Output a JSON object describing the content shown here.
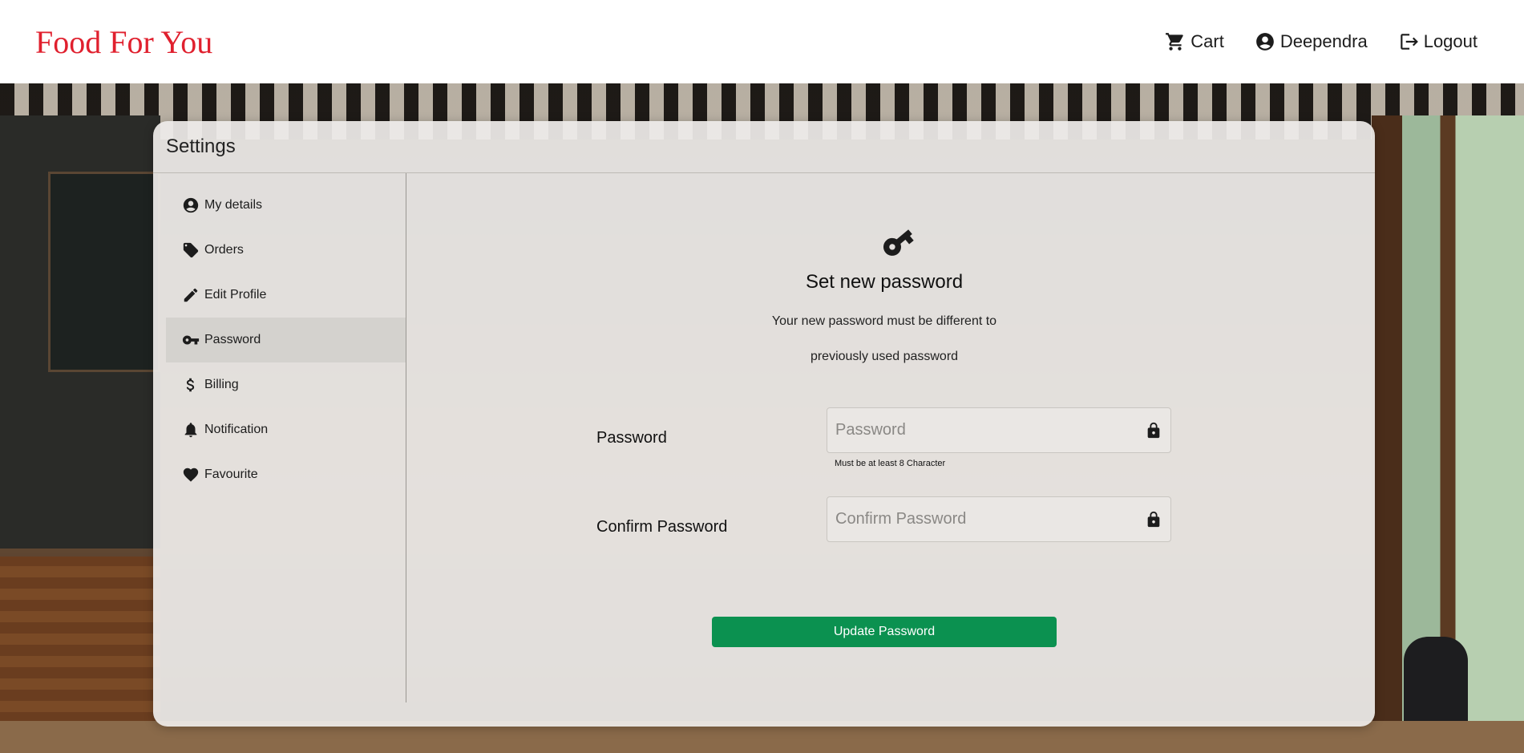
{
  "header": {
    "brand": "Food For You",
    "nav": [
      {
        "label": "Cart",
        "icon": "cart-icon"
      },
      {
        "label": "Deependra",
        "icon": "account-circle-icon"
      },
      {
        "label": "Logout",
        "icon": "logout-icon"
      }
    ],
    "brand_color": "#e0202e"
  },
  "settings": {
    "title": "Settings",
    "sidebar": [
      {
        "label": "My details",
        "icon": "account-circle-icon"
      },
      {
        "label": "Orders",
        "icon": "tag-icon"
      },
      {
        "label": "Edit Profile",
        "icon": "pencil-icon"
      },
      {
        "label": "Password",
        "icon": "key-icon",
        "active": true
      },
      {
        "label": "Billing",
        "icon": "dollar-icon"
      },
      {
        "label": "Notification",
        "icon": "bell-icon"
      },
      {
        "label": "Favourite",
        "icon": "heart-icon"
      }
    ]
  },
  "password_form": {
    "icon": "key-icon",
    "title": "Set new password",
    "desc_line1": "Your new password must be different to",
    "desc_line2": "previously used password",
    "password_label": "Password",
    "password_placeholder": "Password",
    "password_hint": "Must be at least 8 Character",
    "confirm_label": "Confirm Password",
    "confirm_placeholder": "Confirm Password",
    "submit_label": "Update Password",
    "submit_color": "#0b9150"
  }
}
